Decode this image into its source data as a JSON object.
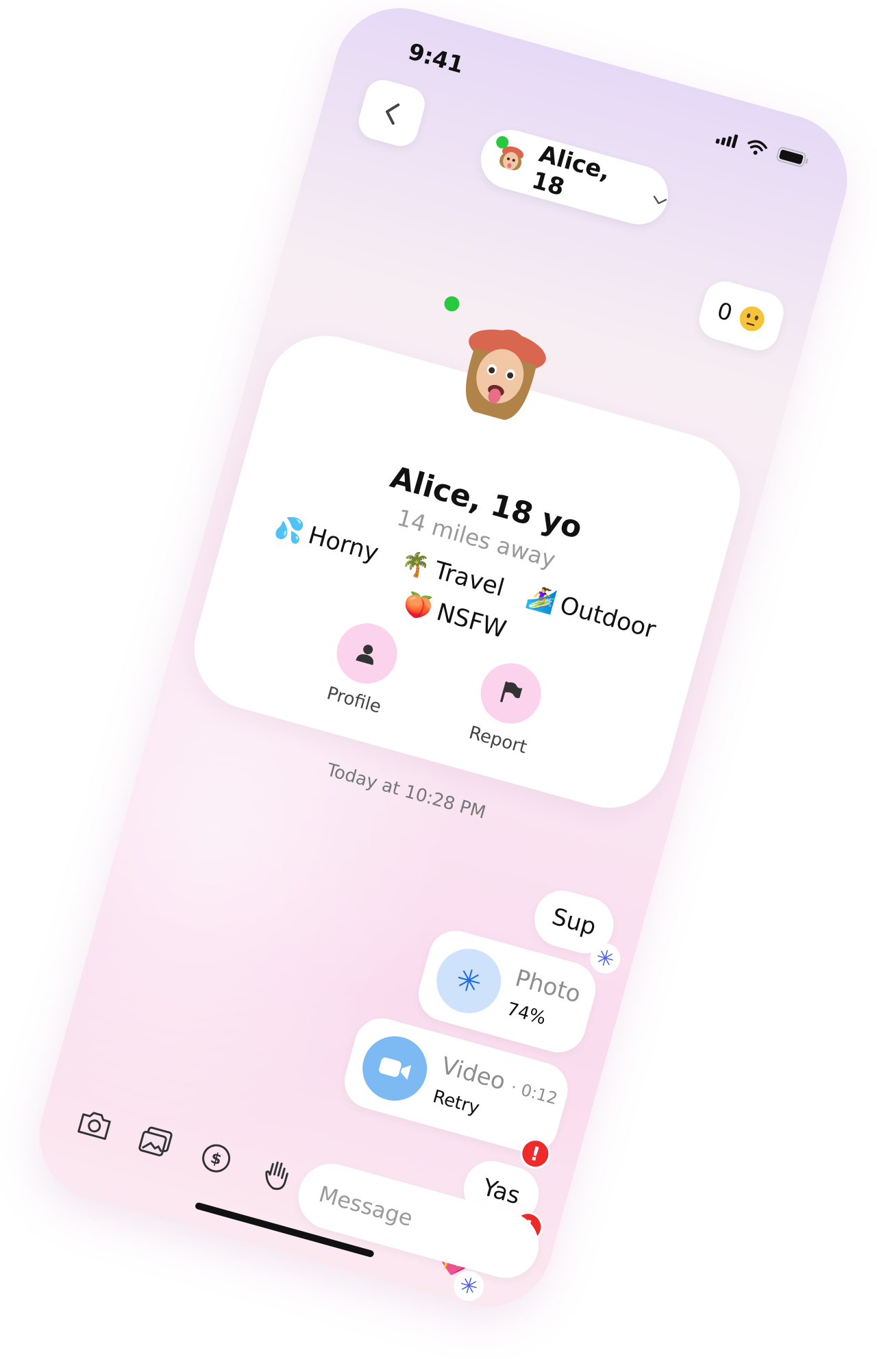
{
  "status_bar": {
    "time": "9:41"
  },
  "header": {
    "name_pill": "Alice, 18",
    "score": "0"
  },
  "profile_card": {
    "name": "Alice, 18 yo",
    "distance": "14 miles away",
    "tags": [
      {
        "emoji": "💦",
        "label": "Horny"
      },
      {
        "emoji": "🌴",
        "label": "Travel"
      },
      {
        "emoji": "🏄‍♀️",
        "label": "Outdoor"
      },
      {
        "emoji": "🍑",
        "label": "NSFW"
      }
    ],
    "actions": {
      "profile_label": "Profile",
      "report_label": "Report"
    }
  },
  "chat": {
    "timestamp": "Today at 10:28 PM",
    "messages": [
      {
        "type": "text",
        "text": "Sup",
        "status": "pending"
      },
      {
        "type": "photo",
        "title": "Photo",
        "subtitle": "74%"
      },
      {
        "type": "video",
        "title": "Video",
        "duration": "· 0:12",
        "subtitle": "Retry",
        "status": "error"
      },
      {
        "type": "text",
        "text": "Yas",
        "status": "error"
      },
      {
        "type": "sticker",
        "emoji": "💖",
        "status": "pending"
      }
    ]
  },
  "composer": {
    "placeholder": "Message",
    "tools": [
      "camera-icon",
      "gallery-icon",
      "dollar-icon",
      "wave-hand-icon"
    ]
  },
  "colors": {
    "accent_pink": "#fbd3ec",
    "online_green": "#27c93f",
    "error_red": "#ee2a2a",
    "pending_blue": "#4c63ea",
    "photo_blue": "#cfe2fb",
    "video_blue": "#7db9f3"
  }
}
